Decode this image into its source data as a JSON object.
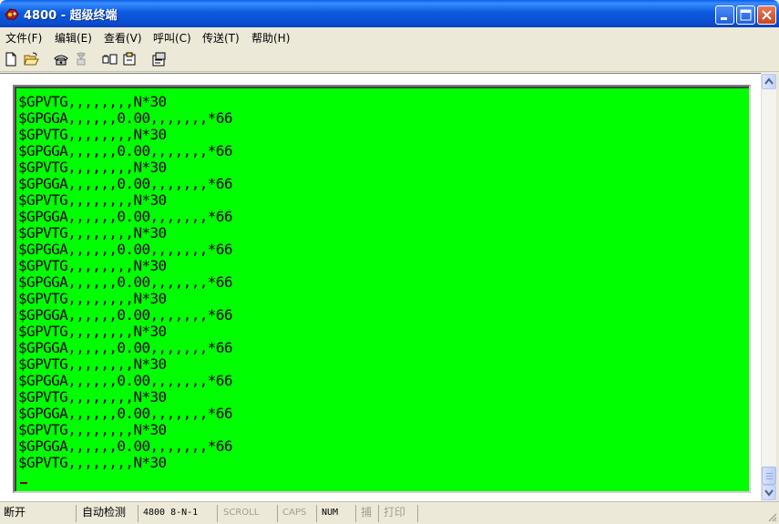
{
  "window": {
    "title": "4800 - 超级终端"
  },
  "menu": [
    {
      "label": "文件(F)"
    },
    {
      "label": "编辑(E)"
    },
    {
      "label": "查看(V)"
    },
    {
      "label": "呼叫(C)"
    },
    {
      "label": "传送(T)"
    },
    {
      "label": "帮助(H)"
    }
  ],
  "toolbar": {
    "icons": [
      "new-document-icon",
      "open-folder-icon",
      "call-phone-icon",
      "disconnect-phone-icon",
      "send-file-icon",
      "receive-file-icon",
      "properties-icon"
    ]
  },
  "terminal": {
    "background_color": "#00FF00",
    "text_color": "#000000",
    "lines": [
      "$GPVTG,,,,,,,,N*30",
      "$GPGGA,,,,,,0.00,,,,,,,*66",
      "$GPVTG,,,,,,,,N*30",
      "$GPGGA,,,,,,0.00,,,,,,,*66",
      "$GPVTG,,,,,,,,N*30",
      "$GPGGA,,,,,,0.00,,,,,,,*66",
      "$GPVTG,,,,,,,,N*30",
      "$GPGGA,,,,,,0.00,,,,,,,*66",
      "$GPVTG,,,,,,,,N*30",
      "$GPGGA,,,,,,0.00,,,,,,,*66",
      "$GPVTG,,,,,,,,N*30",
      "$GPGGA,,,,,,0.00,,,,,,,*66",
      "$GPVTG,,,,,,,,N*30",
      "$GPGGA,,,,,,0.00,,,,,,,*66",
      "$GPVTG,,,,,,,,N*30",
      "$GPGGA,,,,,,0.00,,,,,,,*66",
      "$GPVTG,,,,,,,,N*30",
      "$GPGGA,,,,,,0.00,,,,,,,*66",
      "$GPVTG,,,,,,,,N*30",
      "$GPGGA,,,,,,0.00,,,,,,,*66",
      "$GPVTG,,,,,,,,N*30",
      "$GPGGA,,,,,,0.00,,,,,,,*66",
      "$GPVTG,,,,,,,,N*30"
    ],
    "cursor": "_"
  },
  "statusbar": {
    "connection": "断开",
    "detect": "自动检测",
    "port_settings": "4800 8-N-1",
    "scroll": "SCROLL",
    "caps": "CAPS",
    "num": "NUM",
    "capture": "捕",
    "print": "打印"
  }
}
